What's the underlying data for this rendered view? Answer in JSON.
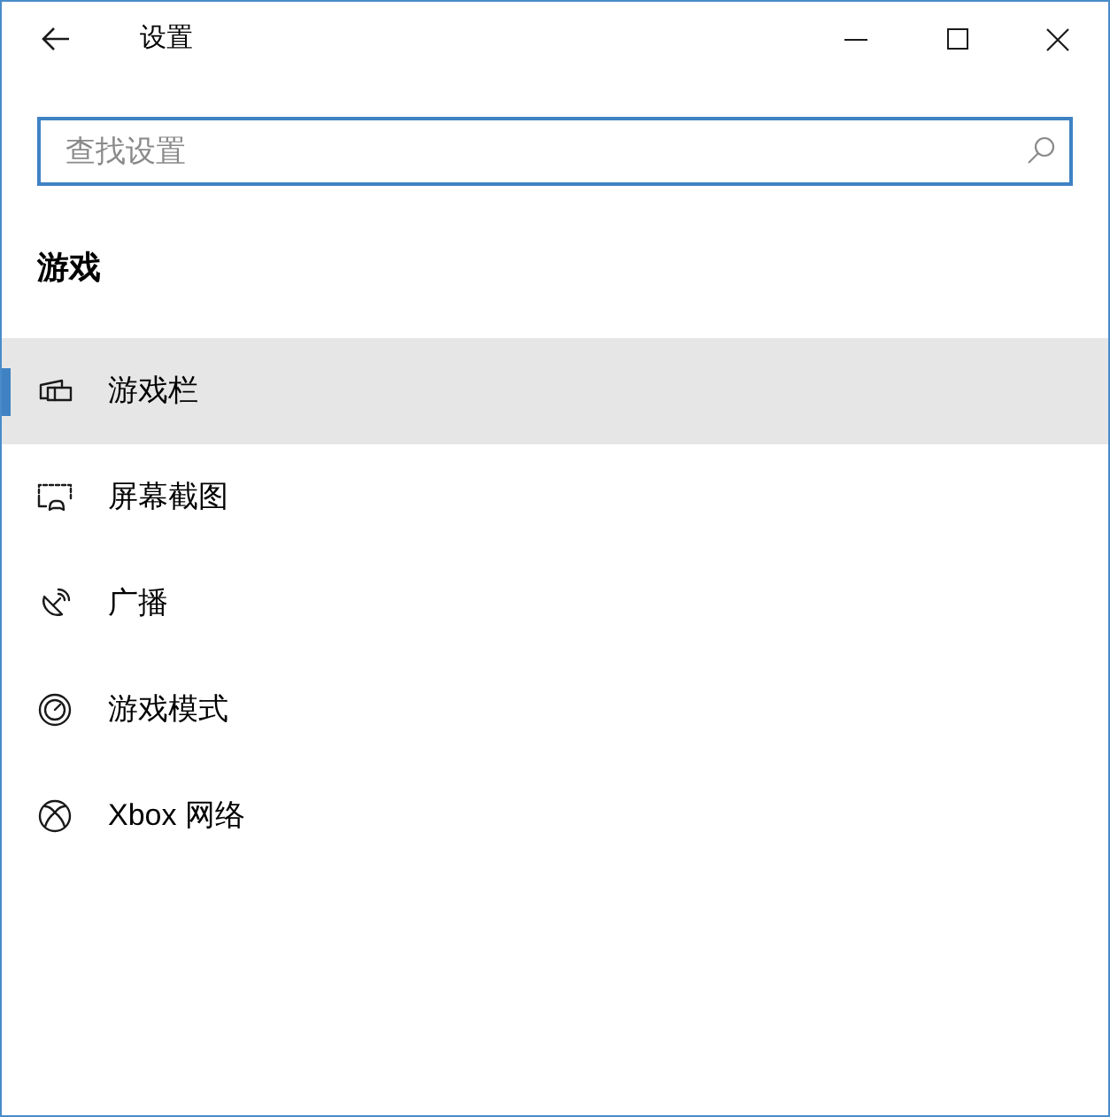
{
  "window": {
    "title": "设置"
  },
  "search": {
    "placeholder": "查找设置"
  },
  "section": {
    "title": "游戏"
  },
  "nav_items": [
    {
      "label": "游戏栏",
      "selected": true,
      "kind": "gamebar"
    },
    {
      "label": "屏幕截图",
      "selected": false,
      "kind": "captures"
    },
    {
      "label": "广播",
      "selected": false,
      "kind": "broadcast"
    },
    {
      "label": "游戏模式",
      "selected": false,
      "kind": "gamemode"
    },
    {
      "label": "Xbox 网络",
      "selected": false,
      "kind": "xbox"
    }
  ]
}
